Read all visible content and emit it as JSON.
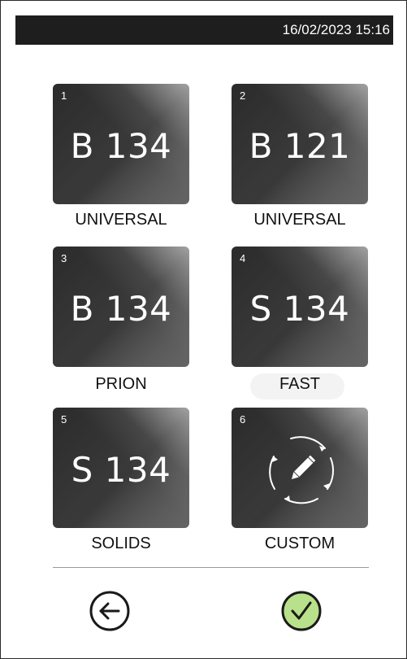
{
  "status_bar": {
    "datetime": "16/02/2023 15:16"
  },
  "programs": [
    {
      "number": "1",
      "code": "B 134",
      "label": "UNIVERSAL"
    },
    {
      "number": "2",
      "code": "B 121",
      "label": "UNIVERSAL"
    },
    {
      "number": "3",
      "code": "B 134",
      "label": "PRION"
    },
    {
      "number": "4",
      "code": "S 134",
      "label": "FAST"
    },
    {
      "number": "5",
      "code": "S 134",
      "label": "SOLIDS"
    },
    {
      "number": "6",
      "code": "",
      "icon": "custom-edit-icon",
      "label": "CUSTOM"
    }
  ],
  "actions": {
    "back_icon": "back-arrow-icon",
    "confirm_icon": "check-icon",
    "confirm_color": "#b9e08a"
  }
}
